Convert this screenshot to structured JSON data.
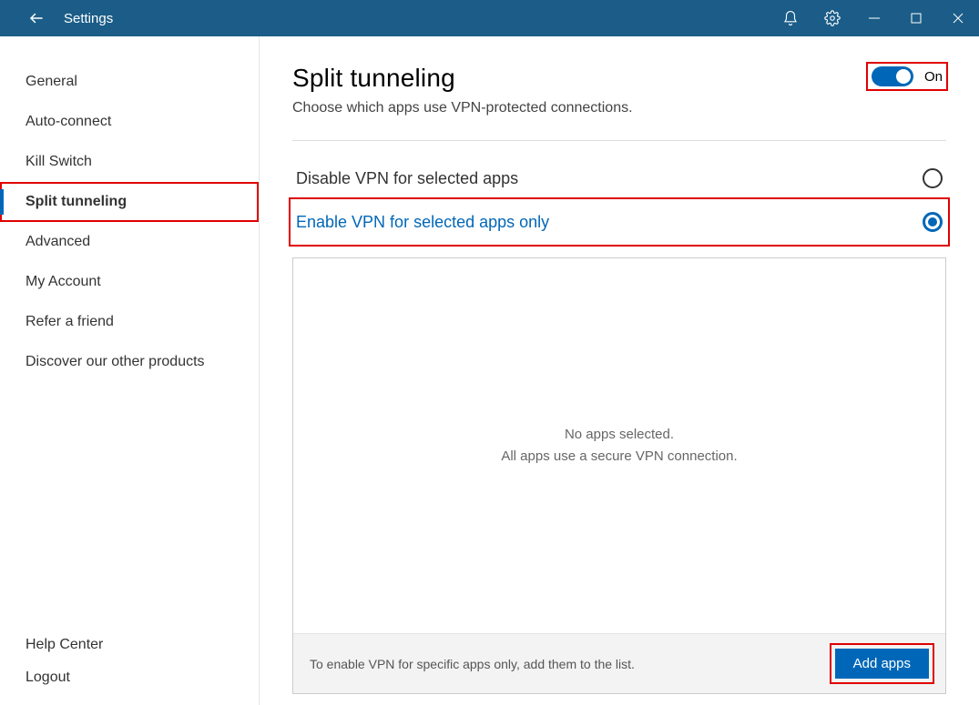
{
  "titlebar": {
    "title": "Settings"
  },
  "sidebar": {
    "items": [
      {
        "label": "General"
      },
      {
        "label": "Auto-connect"
      },
      {
        "label": "Kill Switch"
      },
      {
        "label": "Split tunneling",
        "selected": true,
        "highlighted": true
      },
      {
        "label": "Advanced"
      },
      {
        "label": "My Account"
      },
      {
        "label": "Refer a friend"
      },
      {
        "label": "Discover our other products"
      }
    ],
    "bottom": [
      {
        "label": "Help Center"
      },
      {
        "label": "Logout"
      }
    ]
  },
  "content": {
    "heading": "Split tunneling",
    "subtitle": "Choose which apps use VPN-protected connections.",
    "toggle": {
      "state": "On"
    },
    "options": [
      {
        "label": "Disable VPN for selected apps",
        "selected": false
      },
      {
        "label": "Enable VPN for selected apps only",
        "selected": true,
        "highlighted": true
      }
    ],
    "empty": {
      "line1": "No apps selected.",
      "line2": "All apps use a secure VPN connection."
    },
    "footer": {
      "text": "To enable VPN for specific apps only, add them to the list.",
      "button": "Add apps"
    }
  }
}
